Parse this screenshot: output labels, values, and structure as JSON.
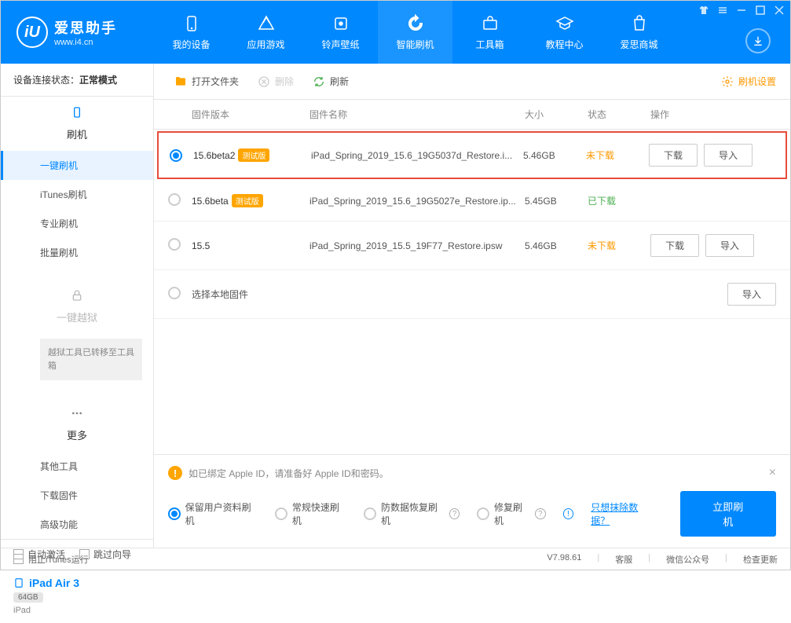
{
  "header": {
    "logo_text": "iU",
    "app_name": "爱思助手",
    "app_url": "www.i4.cn",
    "tabs": [
      {
        "label": "我的设备",
        "icon": "device"
      },
      {
        "label": "应用游戏",
        "icon": "apps"
      },
      {
        "label": "铃声壁纸",
        "icon": "ringtone"
      },
      {
        "label": "智能刷机",
        "icon": "flash"
      },
      {
        "label": "工具箱",
        "icon": "toolbox"
      },
      {
        "label": "教程中心",
        "icon": "tutorial"
      },
      {
        "label": "爱思商城",
        "icon": "store"
      }
    ]
  },
  "sidebar": {
    "status_label": "设备连接状态：",
    "status_value": "正常模式",
    "flash_group": "刷机",
    "items": {
      "oneclick": "一键刷机",
      "itunes": "iTunes刷机",
      "pro": "专业刷机",
      "batch": "批量刷机"
    },
    "jailbreak_group": "一键越狱",
    "jailbreak_notice": "越狱工具已转移至工具箱",
    "more_group": "更多",
    "more_items": {
      "other_tools": "其他工具",
      "download_fw": "下载固件",
      "advanced": "高级功能"
    },
    "auto_activate": "自动激活",
    "skip_guide": "跳过向导",
    "device_name": "iPad Air 3",
    "device_storage": "64GB",
    "device_type": "iPad"
  },
  "toolbar": {
    "open_folder": "打开文件夹",
    "delete": "删除",
    "refresh": "刷新",
    "settings": "刷机设置"
  },
  "table": {
    "headers": {
      "version": "固件版本",
      "name": "固件名称",
      "size": "大小",
      "status": "状态",
      "actions": "操作"
    },
    "rows": [
      {
        "version": "15.6beta2",
        "beta": "测试版",
        "name": "iPad_Spring_2019_15.6_19G5037d_Restore.i...",
        "size": "5.46GB",
        "status": "未下载",
        "status_class": "notdl",
        "selected": true,
        "highlighted": true,
        "show_actions": true
      },
      {
        "version": "15.6beta",
        "beta": "测试版",
        "name": "iPad_Spring_2019_15.6_19G5027e_Restore.ip...",
        "size": "5.45GB",
        "status": "已下载",
        "status_class": "dl",
        "selected": false,
        "highlighted": false,
        "show_actions": false
      },
      {
        "version": "15.5",
        "beta": "",
        "name": "iPad_Spring_2019_15.5_19F77_Restore.ipsw",
        "size": "5.46GB",
        "status": "未下载",
        "status_class": "notdl",
        "selected": false,
        "highlighted": false,
        "show_actions": true
      }
    ],
    "local_row": "选择本地固件",
    "download_btn": "下载",
    "import_btn": "导入"
  },
  "bottom": {
    "warning": "如已绑定 Apple ID，请准备好 Apple ID和密码。",
    "options": {
      "keep_data": "保留用户资料刷机",
      "normal": "常规快速刷机",
      "recovery": "防数据恢复刷机",
      "repair": "修复刷机"
    },
    "erase_link": "只想抹除数据？",
    "flash_btn": "立即刷机"
  },
  "footer": {
    "block_itunes": "阻止iTunes运行",
    "version": "V7.98.61",
    "service": "客服",
    "wechat": "微信公众号",
    "check_update": "检查更新"
  }
}
